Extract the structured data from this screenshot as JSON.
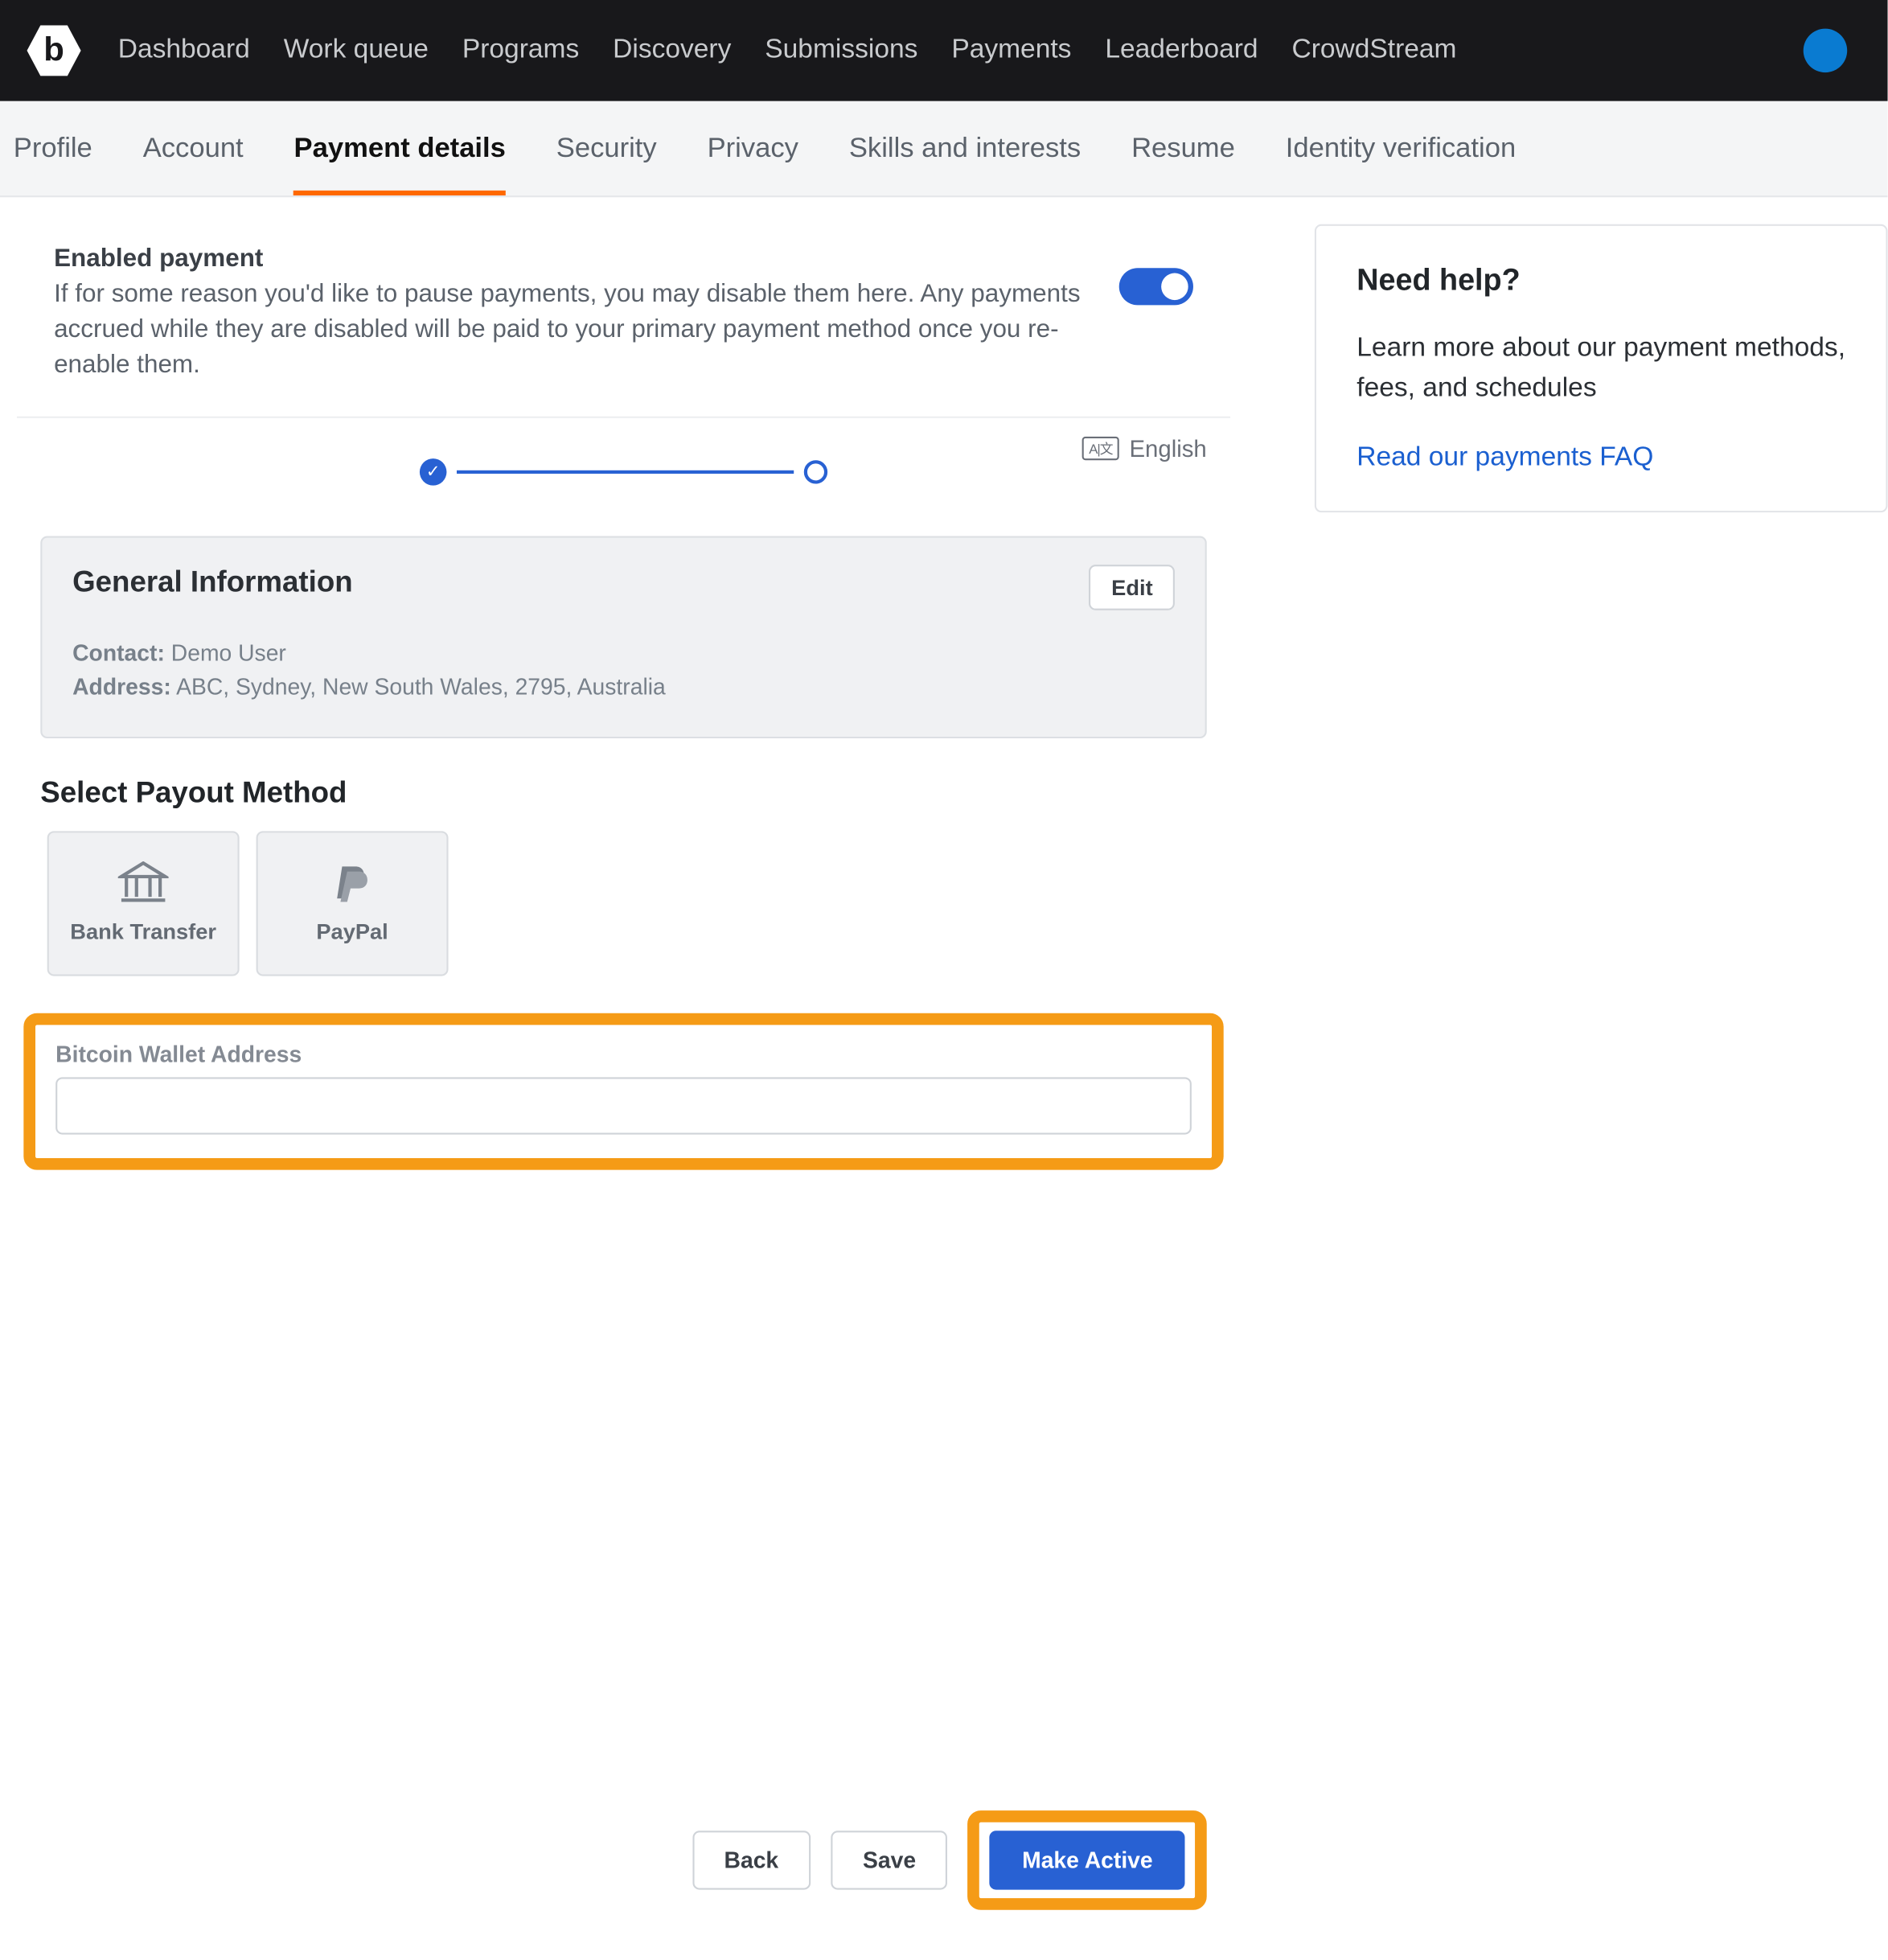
{
  "topnav": {
    "items": [
      "Dashboard",
      "Work queue",
      "Programs",
      "Discovery",
      "Submissions",
      "Payments",
      "Leaderboard",
      "CrowdStream"
    ]
  },
  "tabs": {
    "items": [
      "Profile",
      "Account",
      "Payment details",
      "Security",
      "Privacy",
      "Skills and interests",
      "Resume",
      "Identity verification"
    ],
    "active_index": 2
  },
  "enabled": {
    "title": "Enabled payment",
    "desc": "If for some reason you'd like to pause payments, you may disable them here. Any payments accrued while they are disabled will be paid to your primary payment method once you re-enable them."
  },
  "lang": {
    "label": "English"
  },
  "general": {
    "title": "General Information",
    "edit": "Edit",
    "contact_label": "Contact:",
    "contact_value": "Demo User",
    "address_label": "Address:",
    "address_value": "ABC, Sydney, New South Wales, 2795, Australia"
  },
  "payout": {
    "title": "Select Payout Method",
    "methods": {
      "bank": "Bank Transfer",
      "paypal": "PayPal"
    }
  },
  "bitcoin": {
    "label": "Bitcoin Wallet Address",
    "value": ""
  },
  "buttons": {
    "back": "Back",
    "save": "Save",
    "make_active": "Make Active"
  },
  "help": {
    "title": "Need help?",
    "text": "Learn more about our payment methods, fees, and schedules",
    "link": "Read our payments FAQ"
  },
  "colors": {
    "accent": "#2861d3",
    "highlight": "#f59b16"
  }
}
